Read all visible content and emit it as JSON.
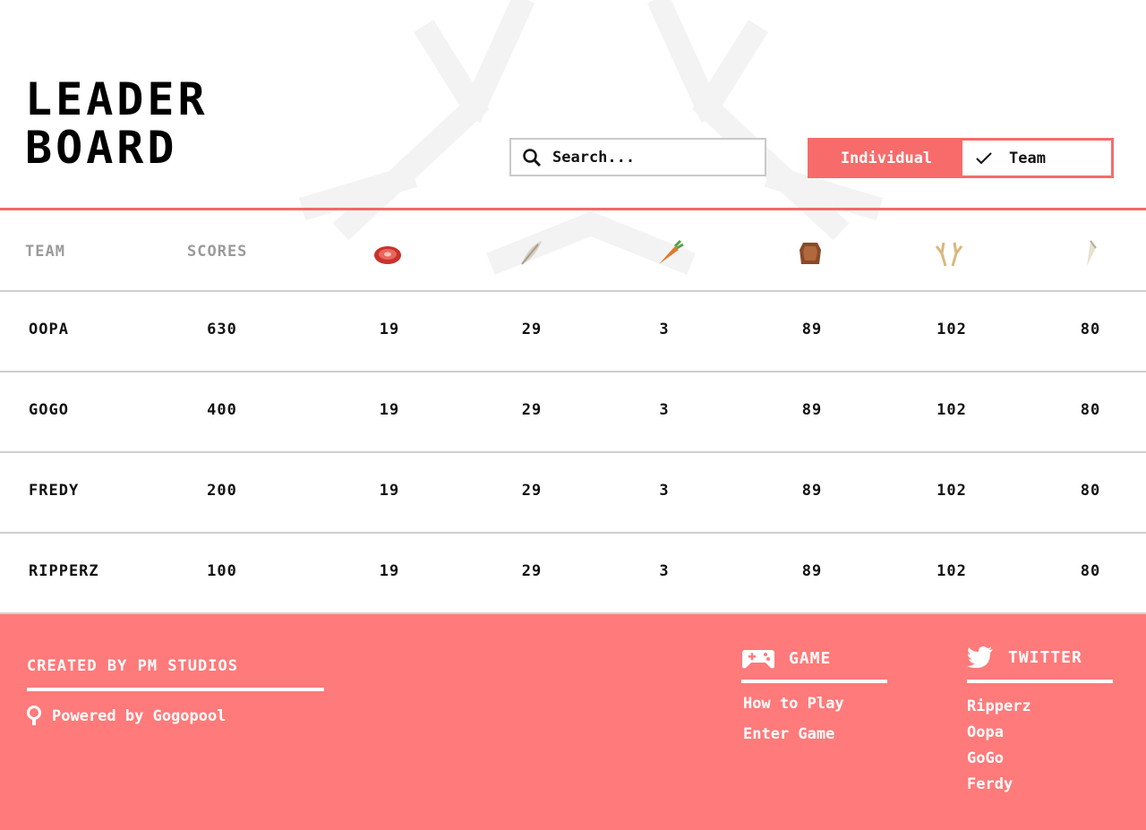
{
  "header": {
    "title_line1": "LEADER",
    "title_line2": "BOARD",
    "search_placeholder": "Search...",
    "toggle": {
      "individual_label": "Individual",
      "team_label": "Team",
      "selected": "Team"
    }
  },
  "colors": {
    "accent": "#f76b6b",
    "footer_bg": "#ff7a7a",
    "header_text": "#9a9a9a"
  },
  "table": {
    "columns": [
      "TEAM",
      "SCORES"
    ],
    "resource_icons": [
      "meat-icon",
      "feather-icon",
      "carrot-icon",
      "hide-icon",
      "antler-icon",
      "tooth-icon"
    ],
    "rows": [
      {
        "team": "OOPA",
        "score": "630",
        "values": [
          "19",
          "29",
          "3",
          "89",
          "102",
          "80"
        ]
      },
      {
        "team": "GOGO",
        "score": "400",
        "values": [
          "19",
          "29",
          "3",
          "89",
          "102",
          "80"
        ]
      },
      {
        "team": "FREDY",
        "score": "200",
        "values": [
          "19",
          "29",
          "3",
          "89",
          "102",
          "80"
        ]
      },
      {
        "team": "RIPPERZ",
        "score": "100",
        "values": [
          "19",
          "29",
          "3",
          "89",
          "102",
          "80"
        ]
      }
    ]
  },
  "footer": {
    "credit": "CREATED BY PM STUDIOS",
    "powered": "Powered by Gogopool",
    "game": {
      "heading": "GAME",
      "links": [
        "How to Play",
        "Enter Game"
      ]
    },
    "twitter": {
      "heading": "TWITTER",
      "links": [
        "Ripperz",
        "Oopa",
        "GoGo",
        "Ferdy"
      ]
    }
  }
}
